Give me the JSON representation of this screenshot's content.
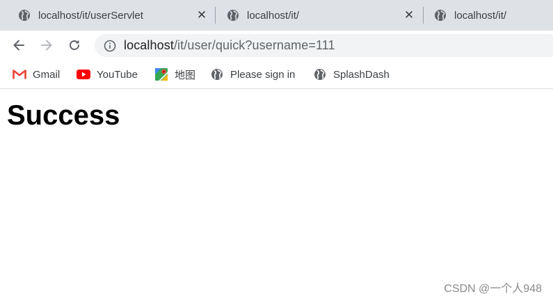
{
  "tabs": [
    {
      "title": "localhost/it/userServlet",
      "icon": "globe-icon",
      "closable": true
    },
    {
      "title": "localhost/it/",
      "icon": "globe-icon",
      "closable": true
    },
    {
      "title": "localhost/it/",
      "icon": "globe-icon",
      "closable": false
    }
  ],
  "toolbar": {
    "back": "arrow-left-icon",
    "forward": "arrow-right-icon",
    "reload": "reload-icon",
    "url_host": "localhost",
    "url_path": "/it/user/quick?username=111"
  },
  "bookmarks": [
    {
      "label": "Gmail",
      "icon": "gmail-icon"
    },
    {
      "label": "YouTube",
      "icon": "youtube-icon"
    },
    {
      "label": "地图",
      "icon": "maps-icon"
    },
    {
      "label": "Please sign in",
      "icon": "globe-icon"
    },
    {
      "label": "SplashDash",
      "icon": "globe-icon"
    }
  ],
  "page": {
    "heading": "Success"
  },
  "watermark": "CSDN @一个人948",
  "colors": {
    "tabstrip": "#dee1e6",
    "omnibox": "#f1f3f4",
    "gmail_red": "#ea4335",
    "youtube_red": "#ff0000"
  }
}
